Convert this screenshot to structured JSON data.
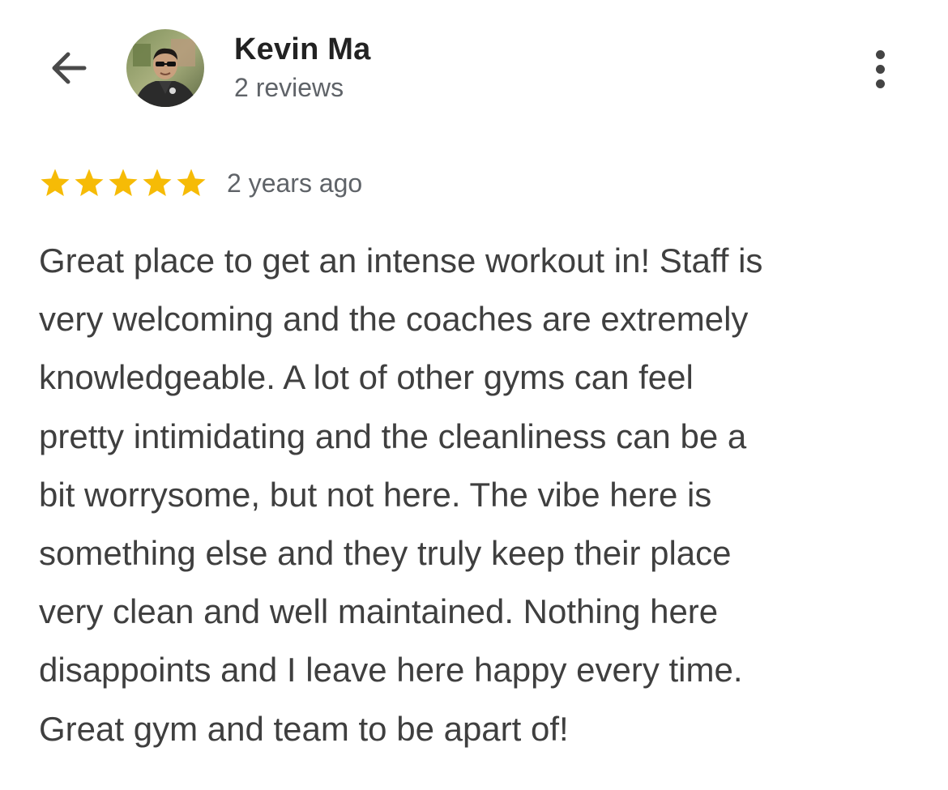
{
  "header": {
    "back_icon": "arrow-left-icon",
    "reviewer_name": "Kevin Ma",
    "review_count": "2 reviews",
    "more_icon": "more-vertical-icon"
  },
  "review": {
    "rating": 5,
    "rating_max": 5,
    "star_color": "#F6BB06",
    "date": "2 years ago",
    "text_lines": [
      "Great place to get an intense workout in! Staff is",
      "very welcoming and the coaches are extremely",
      "knowledgeable. A lot of other gyms can feel",
      "pretty intimidating and the cleanliness can be a",
      "bit worrysome, but not here. The vibe here is",
      "something else and they truly keep their place",
      "very clean and well maintained. Nothing here",
      "disappoints and I leave here happy every time.",
      "Great gym and team to be apart of!"
    ]
  }
}
